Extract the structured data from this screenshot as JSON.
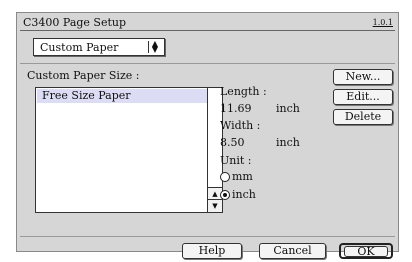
{
  "dialog": {
    "title": "C3400 Page Setup",
    "version": "1.0.1"
  },
  "paper_select": {
    "value": "Custom Paper",
    "arrows": "▲▼"
  },
  "custom_section": {
    "label": "Custom Paper Size :",
    "items": [
      "Free Size Paper"
    ]
  },
  "fields": {
    "length_label": "Length :",
    "length_value": "11.69",
    "length_unit": "inch",
    "width_label": "Width :",
    "width_value": "8.50",
    "width_unit": "inch",
    "unit_label": "Unit :",
    "unit_options": [
      "mm",
      "inch"
    ],
    "unit_selected": "inch"
  },
  "side_buttons": {
    "new": "New...",
    "edit": "Edit...",
    "delete": "Delete"
  },
  "footer_buttons": {
    "help": "Help",
    "cancel": "Cancel",
    "ok": "OK"
  }
}
